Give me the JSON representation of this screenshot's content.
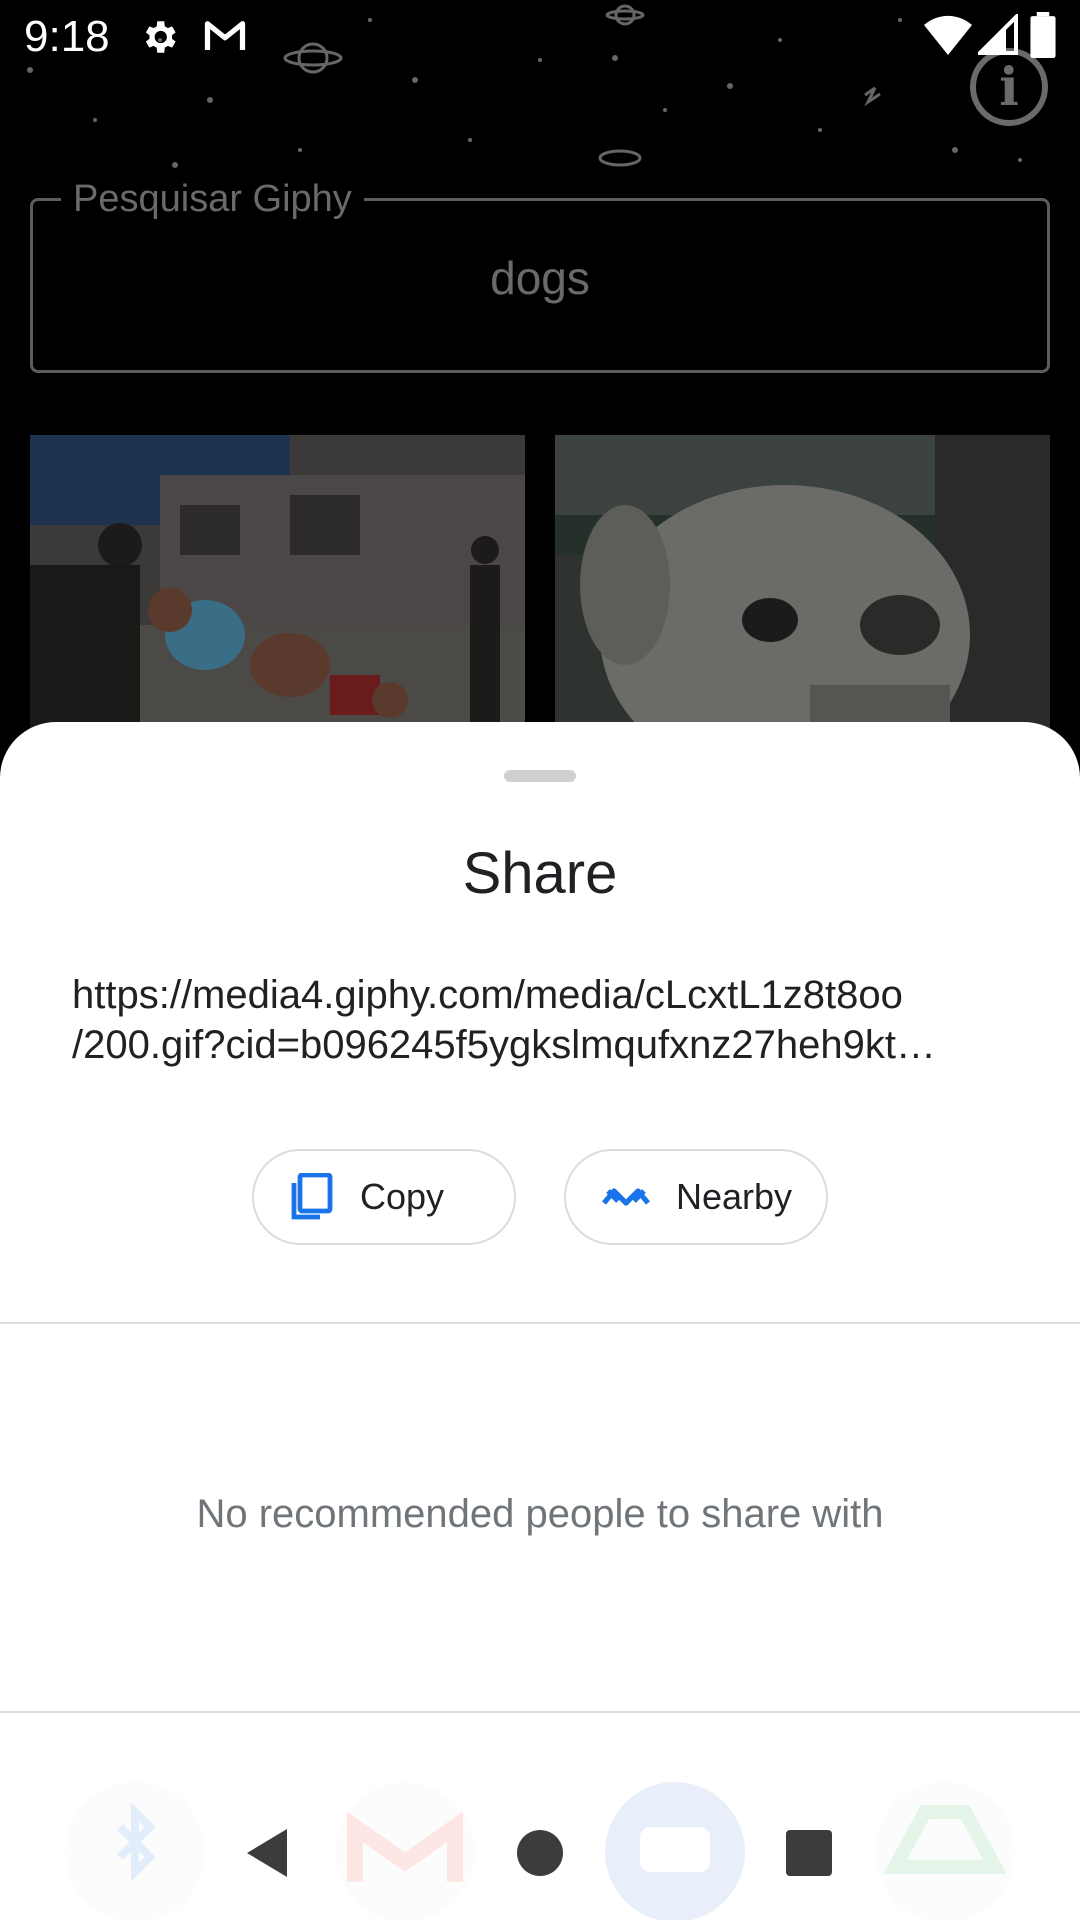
{
  "status_bar": {
    "time": "9:18",
    "icons": [
      "settings-icon",
      "gmail-icon",
      "wifi-icon",
      "signal-icon",
      "battery-icon"
    ]
  },
  "app": {
    "search": {
      "label": "Pesquisar Giphy",
      "value": "dogs"
    },
    "info_icon": "info-icon",
    "results": [
      "gif-result-1",
      "gif-result-2"
    ]
  },
  "share_sheet": {
    "title": "Share",
    "url_line1": "https://media4.giphy.com/media/cLcxtL1z8t8oo",
    "url_line2": "/200.gif?cid=b096245f5ygkslmqufxnz27heh9kt…",
    "actions": [
      {
        "label": "Copy",
        "icon": "copy-icon"
      },
      {
        "label": "Nearby",
        "icon": "nearby-share-icon"
      }
    ],
    "empty_people_text": "No recommended people to share with",
    "app_row": [
      "bluetooth-icon",
      "gmail-icon",
      "messages-icon",
      "drive-icon"
    ]
  },
  "nav_bar": {
    "buttons": [
      "back-icon",
      "home-icon",
      "recents-icon"
    ]
  },
  "colors": {
    "sheet_background": "#ffffff",
    "accent_blue": "#1a73e8",
    "text_primary": "#202124",
    "text_secondary": "#70757a",
    "divider": "#dadce0"
  }
}
